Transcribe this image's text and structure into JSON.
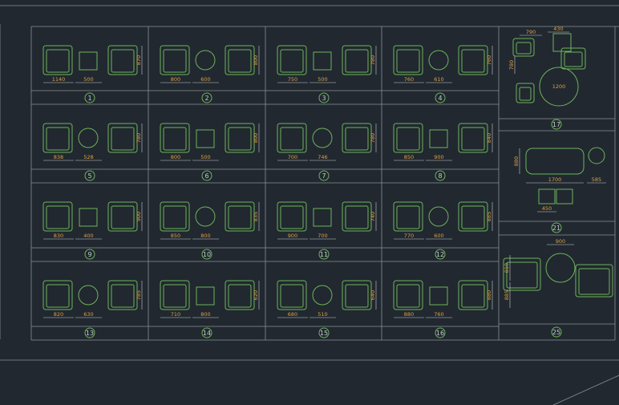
{
  "colors": {
    "background": "#212830",
    "frame": "#8a9096",
    "furniture": "#6db35a",
    "dimension_text": "#e0a040",
    "linework": "#c8ccd0"
  },
  "cells": [
    {
      "label": "1",
      "dims": [
        "1140",
        "500",
        "870"
      ]
    },
    {
      "label": "2",
      "dims": [
        "800",
        "600",
        "800"
      ]
    },
    {
      "label": "3",
      "dims": [
        "750",
        "500",
        "780"
      ]
    },
    {
      "label": "4",
      "dims": [
        "760",
        "610",
        "760"
      ]
    },
    {
      "label": "5",
      "dims": [
        "838",
        "528",
        "780"
      ]
    },
    {
      "label": "6",
      "dims": [
        "800",
        "500",
        "800"
      ]
    },
    {
      "label": "7",
      "dims": [
        "700",
        "746",
        "780"
      ]
    },
    {
      "label": "8",
      "dims": [
        "850",
        "900",
        "840"
      ]
    },
    {
      "label": "9",
      "dims": [
        "830",
        "400",
        "900"
      ]
    },
    {
      "label": "10",
      "dims": [
        "850",
        "800",
        "835"
      ]
    },
    {
      "label": "11",
      "dims": [
        "900",
        "700",
        "740"
      ]
    },
    {
      "label": "12",
      "dims": [
        "770",
        "600",
        "885"
      ]
    },
    {
      "label": "13",
      "dims": [
        "820",
        "630",
        "785"
      ]
    },
    {
      "label": "14",
      "dims": [
        "710",
        "800",
        "620"
      ]
    },
    {
      "label": "15",
      "dims": [
        "680",
        "510",
        "640"
      ]
    },
    {
      "label": "16",
      "dims": [
        "880",
        "760",
        "880"
      ]
    },
    {
      "label": "17",
      "dims": [
        "790",
        "430",
        "780",
        "1200"
      ]
    },
    {
      "label": "21",
      "dims": [
        "1700",
        "585",
        "880",
        "450"
      ]
    },
    {
      "label": "25",
      "dims": [
        "900",
        "810",
        "885"
      ]
    }
  ]
}
